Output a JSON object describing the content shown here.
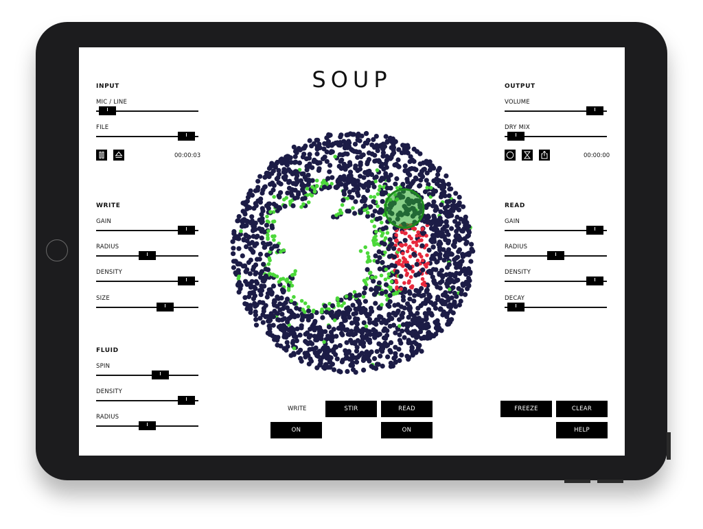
{
  "app": {
    "title": "SOUP"
  },
  "input": {
    "title": "INPUT",
    "mic_line": {
      "label": "MIC / LINE",
      "value": 0.03
    },
    "file": {
      "label": "FILE",
      "value": 0.96
    },
    "pause_icon": "pause-icon",
    "eject_icon": "eject-icon",
    "time": "00:00:03"
  },
  "output": {
    "title": "OUTPUT",
    "volume": {
      "label": "VOLUME",
      "value": 0.96
    },
    "dry_mix": {
      "label": "DRY MIX",
      "value": 0.03
    },
    "record_icon": "record-icon",
    "hourglass_icon": "hourglass-icon",
    "share_icon": "share-icon",
    "time": "00:00:00"
  },
  "write": {
    "title": "WRITE",
    "gain": {
      "label": "GAIN",
      "value": 0.96
    },
    "radius": {
      "label": "RADIUS",
      "value": 0.5
    },
    "density": {
      "label": "DENSITY",
      "value": 0.96
    },
    "size": {
      "label": "SIZE",
      "value": 0.71
    }
  },
  "read": {
    "title": "READ",
    "gain": {
      "label": "GAIN",
      "value": 0.96
    },
    "radius": {
      "label": "RADIUS",
      "value": 0.5
    },
    "density": {
      "label": "DENSITY",
      "value": 0.96
    },
    "decay": {
      "label": "DECAY",
      "value": 0.03
    }
  },
  "fluid": {
    "title": "FLUID",
    "spin": {
      "label": "SPIN",
      "value": 0.65
    },
    "density": {
      "label": "DENSITY",
      "value": 0.96
    },
    "radius": {
      "label": "RADIUS",
      "value": 0.5
    }
  },
  "controls": {
    "write_label": "WRITE",
    "write_state": "ON",
    "stir": "STIR",
    "read": "READ",
    "read_state": "ON",
    "freeze": "FREEZE",
    "clear": "CLEAR",
    "help": "HELP"
  },
  "colors": {
    "particle": "#1c1c46",
    "written": "#4cd83a",
    "read": "#e8283c",
    "bright": "#9cf57a"
  }
}
